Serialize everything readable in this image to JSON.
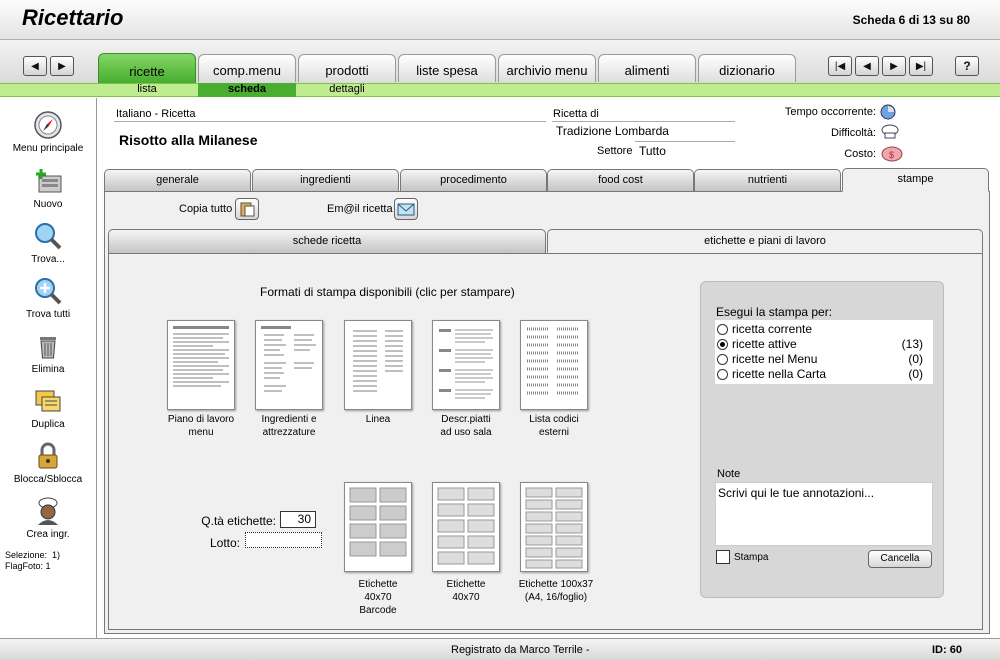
{
  "app": {
    "title": "Ricettario",
    "record_counter": "Scheda 6 di 13 su 80",
    "help_label": "?"
  },
  "main_tabs": [
    {
      "label": "ricette",
      "active": true
    },
    {
      "label": "comp.menu"
    },
    {
      "label": "prodotti"
    },
    {
      "label": "liste spesa"
    },
    {
      "label": "archivio menu"
    },
    {
      "label": "alimenti"
    },
    {
      "label": "dizionario"
    }
  ],
  "sub_tabs": [
    {
      "label": "lista"
    },
    {
      "label": "scheda",
      "active": true
    },
    {
      "label": "dettagli"
    }
  ],
  "sidebar": {
    "items": [
      {
        "label": "Menu principale",
        "icon": "compass-icon"
      },
      {
        "label": "Nuovo",
        "icon": "new-record-icon"
      },
      {
        "label": "Trova...",
        "icon": "magnifier-icon"
      },
      {
        "label": "Trova tutti",
        "icon": "magnifier-plus-icon"
      },
      {
        "label": "Elimina",
        "icon": "trash-icon"
      },
      {
        "label": "Duplica",
        "icon": "duplicate-icon"
      },
      {
        "label": "Blocca/Sblocca",
        "icon": "padlock-icon"
      },
      {
        "label": "Crea ingr.",
        "icon": "chef-icon"
      }
    ],
    "selection_label": "Selezione:",
    "selection_value": "1)",
    "flagfoto_label": "FlagFoto:",
    "flagfoto_value": "1"
  },
  "recipe": {
    "language_label": "Italiano - Ricetta",
    "name": "Risotto alla Milanese",
    "origin_label": "Ricetta di",
    "origin_value": "Tradizione Lombarda",
    "sector_label": "Settore",
    "sector_value": "Tutto",
    "time_label": "Tempo occorrente:",
    "difficulty_label": "Difficoltà:",
    "cost_label": "Costo:"
  },
  "detail_tabs": [
    {
      "label": "generale"
    },
    {
      "label": "ingredienti"
    },
    {
      "label": "procedimento"
    },
    {
      "label": "food cost"
    },
    {
      "label": "nutrienti"
    },
    {
      "label": "stampe",
      "active": true
    }
  ],
  "actions": {
    "copy_all": "Copia tutto",
    "email_recipe": "Em@il ricetta"
  },
  "print_tabs": [
    {
      "label": "schede ricetta"
    },
    {
      "label": "etichette e piani di lavoro",
      "active": true
    }
  ],
  "print_formats": {
    "heading": "Formati di stampa disponibili (clic per stampare)",
    "items": [
      {
        "label_1": "Piano di lavoro",
        "label_2": "menu"
      },
      {
        "label_1": "Ingredienti e",
        "label_2": "attrezzature"
      },
      {
        "label_1": "Linea",
        "label_2": ""
      },
      {
        "label_1": "Descr.piatti",
        "label_2": "ad uso sala"
      },
      {
        "label_1": "Lista codici",
        "label_2": "esterni"
      }
    ],
    "labels": [
      {
        "label_1": "Etichette",
        "label_2": "40x70",
        "label_3": "Barcode"
      },
      {
        "label_1": "Etichette",
        "label_2": "40x70",
        "label_3": ""
      },
      {
        "label_1": "Etichette 100x37",
        "label_2": "(A4, 16/foglio)",
        "label_3": ""
      }
    ],
    "qty_label": "Q.tà etichette:",
    "qty_value": "30",
    "lot_label": "Lotto:",
    "lot_value": ""
  },
  "print_for": {
    "heading": "Esegui la stampa per:",
    "options": [
      {
        "label": "ricetta corrente",
        "count": "",
        "selected": false
      },
      {
        "label": "ricette attive",
        "count": "(13)",
        "selected": true
      },
      {
        "label": "ricette nel Menu",
        "count": "(0)",
        "selected": false
      },
      {
        "label": "ricette nella Carta",
        "count": "(0)",
        "selected": false
      }
    ],
    "notes_label": "Note",
    "notes_value": "Scrivi qui le tue annotazioni...",
    "print_checkbox_label": "Stampa",
    "cancel_label": "Cancella"
  },
  "footer": {
    "registered": "Registrato da Marco Terrile -",
    "id": "ID: 60"
  },
  "colors": {
    "accent_green": "#49ae2f",
    "subbar_green": "#c0ec90"
  }
}
